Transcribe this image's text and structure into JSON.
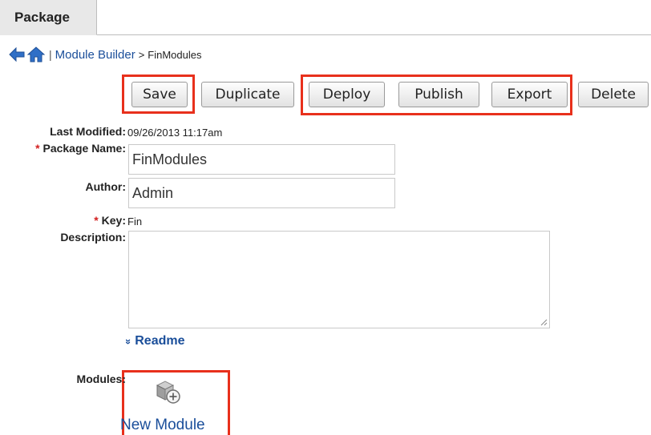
{
  "tabs": [
    {
      "label": "Package"
    }
  ],
  "breadcrumb": {
    "link": "Module Builder",
    "arrow": ">",
    "current": "FinModules",
    "separator": "|"
  },
  "toolbar": {
    "save": "Save",
    "duplicate": "Duplicate",
    "deploy": "Deploy",
    "publish": "Publish",
    "export": "Export",
    "delete": "Delete"
  },
  "form": {
    "last_modified_label": "Last Modified:",
    "last_modified_value": "09/26/2013 11:17am",
    "package_name_label": "Package Name:",
    "package_name_value": "FinModules",
    "author_label": "Author:",
    "author_value": "Admin",
    "key_label": "Key:",
    "key_value": "Fin",
    "description_label": "Description:",
    "description_value": "",
    "required_marker": "*"
  },
  "readme": {
    "label": "Readme",
    "chevron": "»"
  },
  "modules": {
    "label": "Modules:",
    "new_module": "New Module"
  },
  "colors": {
    "highlight": "#e8301c",
    "link": "#1a4e9a",
    "required": "#d21f1f"
  },
  "icons": [
    "back-arrow-icon",
    "home-icon",
    "chevron-down-icon",
    "new-module-icon"
  ]
}
